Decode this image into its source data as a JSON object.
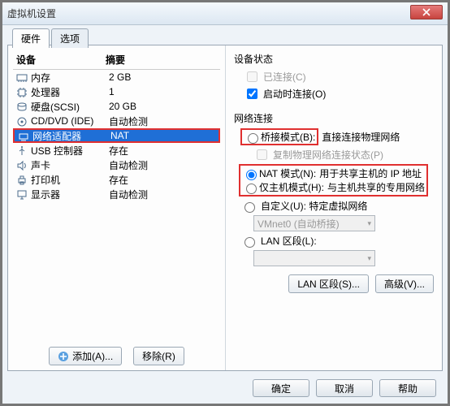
{
  "window": {
    "title": "虚拟机设置"
  },
  "tabs": {
    "hardware": "硬件",
    "options": "选项"
  },
  "columns": {
    "device": "设备",
    "summary": "摘要"
  },
  "devices": [
    {
      "name": "内存",
      "summary": "2 GB",
      "icon": "memory"
    },
    {
      "name": "处理器",
      "summary": "1",
      "icon": "cpu"
    },
    {
      "name": "硬盘(SCSI)",
      "summary": "20 GB",
      "icon": "disk"
    },
    {
      "name": "CD/DVD (IDE)",
      "summary": "自动检测",
      "icon": "cd"
    },
    {
      "name": "网络适配器",
      "summary": "NAT",
      "icon": "net",
      "selected": true
    },
    {
      "name": "USB 控制器",
      "summary": "存在",
      "icon": "usb"
    },
    {
      "name": "声卡",
      "summary": "自动检测",
      "icon": "sound"
    },
    {
      "name": "打印机",
      "summary": "存在",
      "icon": "printer"
    },
    {
      "name": "显示器",
      "summary": "自动检测",
      "icon": "display"
    }
  ],
  "left_buttons": {
    "add": "添加(A)...",
    "remove": "移除(R)"
  },
  "device_state": {
    "label": "设备状态",
    "connected": "已连接(C)",
    "connect_at_power_on": "启动时连接(O)"
  },
  "network": {
    "label": "网络连接",
    "bridged": "桥接模式(B):",
    "bridged_desc": "直接连接物理网络",
    "replicate": "复制物理网络连接状态(P)",
    "nat": "NAT 模式(N):",
    "nat_desc": "用于共享主机的 IP 地址",
    "hostonly": "仅主机模式(H):",
    "hostonly_desc": "与主机共享的专用网络",
    "custom": "自定义(U): 特定虚拟网络",
    "custom_value": "VMnet0 (自动桥接)",
    "lan": "LAN 区段(L):",
    "lan_value": ""
  },
  "right_buttons": {
    "lan_segments": "LAN 区段(S)...",
    "advanced": "高级(V)..."
  },
  "dialog_buttons": {
    "ok": "确定",
    "cancel": "取消",
    "help": "帮助"
  }
}
